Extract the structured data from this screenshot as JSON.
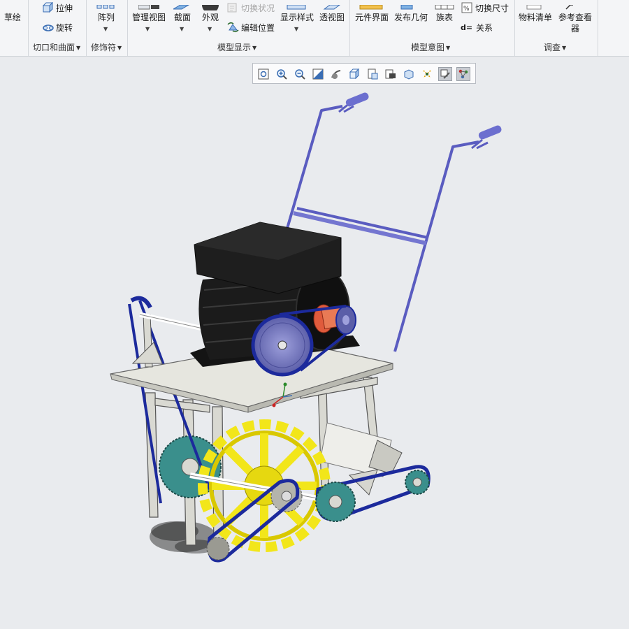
{
  "ribbon": {
    "sketch_label": "草绘",
    "extrude_label": "拉伸",
    "revolve_label": "旋转",
    "pattern_label": "阵列",
    "manage_views_label": "管理视图",
    "section_label": "截面",
    "appearance_label": "外观",
    "toggle_status_label": "切换状况",
    "edit_position_label": "编辑位置",
    "display_style_label": "显示样式",
    "perspective_label": "透视图",
    "component_interface_label": "元件界面",
    "publish_geometry_label": "发布几何",
    "family_table_label": "族表",
    "switch_dimensions_label": "切换尺寸",
    "relations_label": "关系",
    "relations_prefix": "d=",
    "bom_label": "物料清单",
    "reference_viewer_label": "参考查看",
    "reference_viewer_label_2": "器",
    "groups": {
      "cut_surface": "切口和曲面",
      "modifiers": "修饰符",
      "model_display": "模型显示",
      "model_intent": "模型意图",
      "investigate": "调查"
    }
  },
  "view_toolbar": {
    "buttons": [
      "refit-icon",
      "zoom-in-icon",
      "zoom-out-icon",
      "repaint-icon",
      "display-style-icon",
      "saved-orientation-icon",
      "named-views-icon",
      "view-manager-icon",
      "datum-display-icon",
      "spin-center-icon",
      "annotation-display-icon",
      "appearance-toggle-icon"
    ]
  },
  "colors": {
    "ribbon_bg": "#f4f5f7",
    "viewport_bg": "#e9ebee",
    "frame": "#5556b8",
    "motor": "#1b1b1b",
    "sprocket_yellow": "#f2e61a",
    "sprocket_teal": "#3a8f8c",
    "chain": "#1c2a9c",
    "deck": "#e6e6df"
  }
}
